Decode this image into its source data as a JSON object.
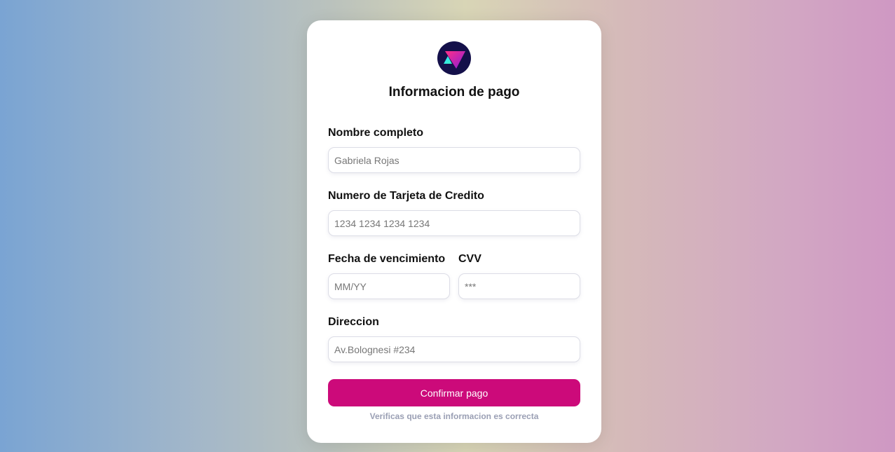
{
  "form": {
    "title": "Informacion de pago",
    "name_label": "Nombre completo",
    "name_placeholder": "Gabriela Rojas",
    "card_label": "Numero de Tarjeta de Credito",
    "card_placeholder": "1234 1234 1234 1234",
    "expiry_label": "Fecha de vencimiento",
    "expiry_placeholder": "MM/YY",
    "cvv_label": "CVV",
    "cvv_placeholder": "***",
    "address_label": "Direccion",
    "address_placeholder": "Av.Bolognesi #234",
    "confirm_label": "Confirmar pago",
    "note": "Verificas que esta informacion es correcta"
  },
  "logo": {
    "icon": "triangle-logo-icon"
  },
  "colors": {
    "accent": "#cc0a7a",
    "card_bg": "#ffffff",
    "note": "#9a9fb4"
  }
}
